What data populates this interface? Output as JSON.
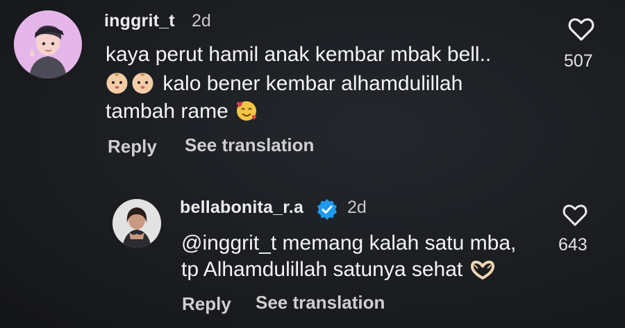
{
  "comments": [
    {
      "username": "inggrit_t",
      "time": "2d",
      "lines": [
        "kaya perut hamil anak kembar mbak bell..",
        "kalo bener kembar alhamdulillah",
        "tambah rame"
      ],
      "emojis": [
        "baby-face-icon",
        "baby-face-icon",
        "smiling-face-with-hearts-icon"
      ],
      "likes": "507",
      "reply_label": "Reply",
      "translate_label": "See translation"
    },
    {
      "username": "bellabonita_r.a",
      "verified": true,
      "time": "2d",
      "lines": [
        "@inggrit_t memang kalah satu mba,",
        "tp Alhamdulillah satunya sehat"
      ],
      "emojis": [
        "heart-hands-icon"
      ],
      "likes": "643",
      "reply_label": "Reply",
      "translate_label": "See translation"
    }
  ],
  "colors": {
    "background": "#1b1d21",
    "verified_badge": "#1d9bf0",
    "text": "#f5f5f5"
  }
}
